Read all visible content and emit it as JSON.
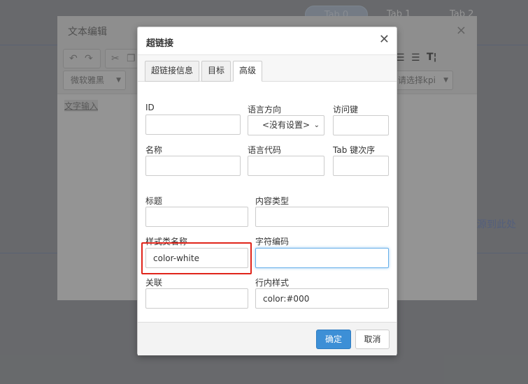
{
  "background": {
    "tabs": [
      "Tab 0",
      "Tab 1",
      "Tab 2"
    ],
    "link_fragment": "源到此处"
  },
  "editor": {
    "title": "文本编辑",
    "font_select": "微软雅黑",
    "kpi_select": "请选择kpi",
    "content_text": "文字输入"
  },
  "dialog": {
    "title": "超链接",
    "tabs": [
      {
        "label": "超链接信息",
        "active": false
      },
      {
        "label": "目标",
        "active": false
      },
      {
        "label": "高级",
        "active": true
      }
    ],
    "fields": {
      "id": {
        "label": "ID",
        "value": ""
      },
      "lang_dir": {
        "label": "语言方向",
        "value": "<没有设置>"
      },
      "access_key": {
        "label": "访问键",
        "value": ""
      },
      "name": {
        "label": "名称",
        "value": ""
      },
      "lang_code": {
        "label": "语言代码",
        "value": ""
      },
      "tab_index": {
        "label": "Tab 键次序",
        "value": ""
      },
      "title": {
        "label": "标题",
        "value": ""
      },
      "content_type": {
        "label": "内容类型",
        "value": ""
      },
      "style_class": {
        "label": "样式类名称",
        "value": "color-white"
      },
      "charset": {
        "label": "字符编码",
        "value": ""
      },
      "rel": {
        "label": "关联",
        "value": ""
      },
      "inline_style": {
        "label": "行内样式",
        "value": "color:#000"
      }
    },
    "ok_label": "确定",
    "cancel_label": "取消"
  },
  "colors": {
    "primary_button": "#3d8fd6",
    "highlight_box": "#e0241a",
    "focus_border": "#66afe9"
  }
}
